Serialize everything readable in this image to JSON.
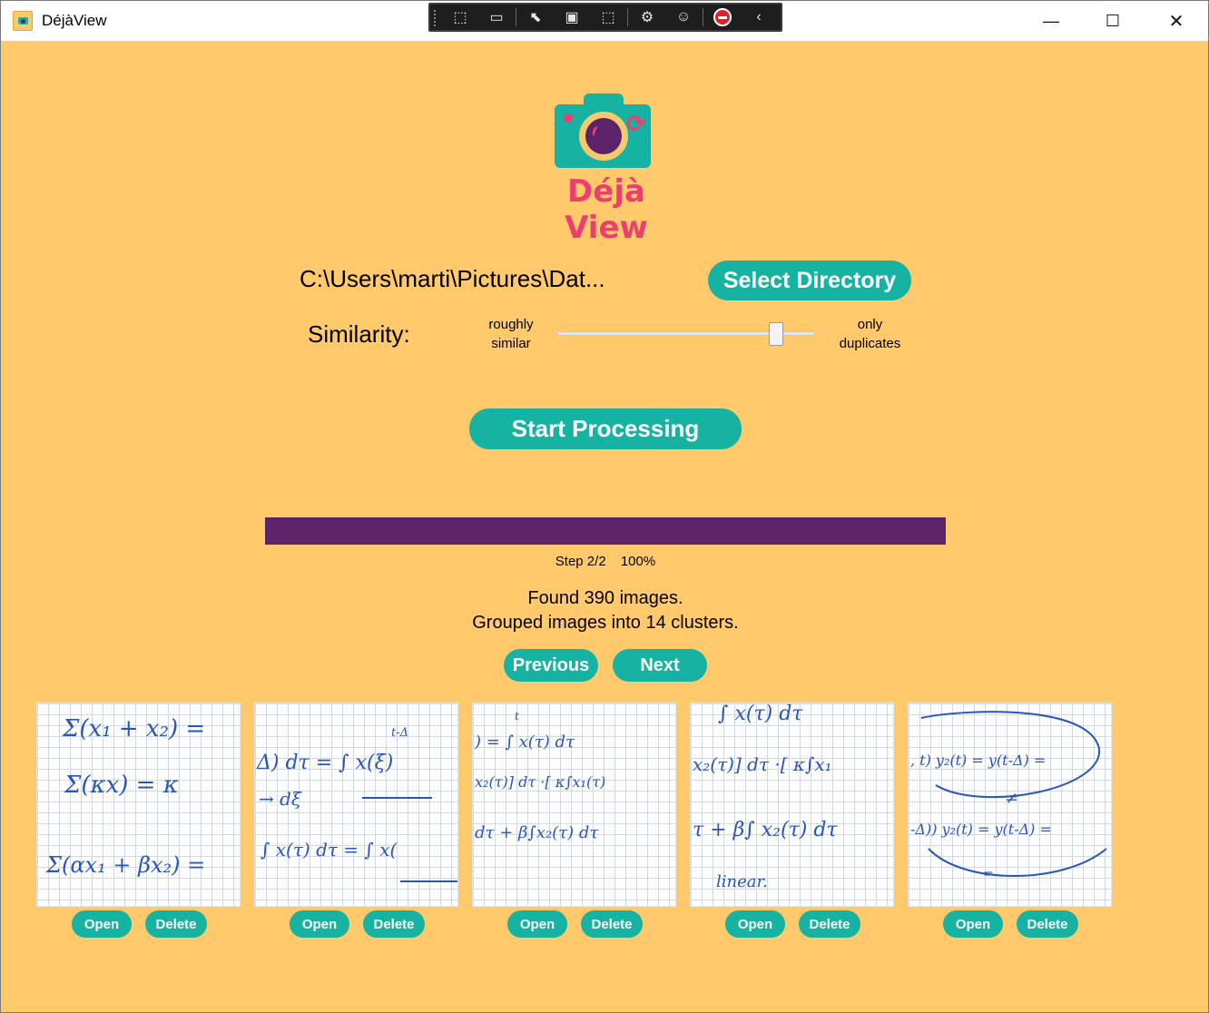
{
  "window": {
    "title": "DéjàView",
    "minimize": "—",
    "maximize": "☐",
    "close": "✕"
  },
  "devtools": {
    "icons": [
      "live-visual-tree-icon",
      "video-icon",
      "select-element-icon",
      "display-layout-icon",
      "track-focus-icon",
      "hot-reload-icon",
      "accessibility-icon",
      "stop-icon",
      "collapse-icon"
    ]
  },
  "logo": {
    "text": "Déjà View",
    "colors": {
      "accent": "#ec3f70",
      "teal": "#16b3a3",
      "purple": "#5c2368"
    }
  },
  "directory": {
    "path": "C:\\Users\\marti\\Pictures\\Dat...",
    "select_label": "Select Directory"
  },
  "similarity": {
    "label": "Similarity:",
    "left_line1": "roughly",
    "left_line2": "similar",
    "right_line1": "only",
    "right_line2": "duplicates",
    "value": 0.85
  },
  "start_label": "Start Processing",
  "progress": {
    "step": "Step 2/2",
    "percent": "100%",
    "value": 1.0
  },
  "results": {
    "line1": "Found 390 images.",
    "line2": "Grouped images into 14 clusters."
  },
  "nav": {
    "previous": "Previous",
    "next": "Next"
  },
  "thumbnails": [
    {
      "open": "Open",
      "delete": "Delete",
      "formula": [
        "Σ(x₁ + x₂) =",
        "Σ(κx) = κ",
        "Σ(αx₁ + βx₂) ="
      ]
    },
    {
      "open": "Open",
      "delete": "Delete",
      "formula": [
        "t-Δ",
        "Δ) dτ = ∫ x(ξ)",
        "→ dξ",
        "∫ x(τ) dτ = ∫ x("
      ]
    },
    {
      "open": "Open",
      "delete": "Delete",
      "formula": [
        "t",
        ") = ∫ x(τ) dτ",
        "x₂(τ)] dτ ·[ κ∫x₁(τ)",
        "dτ + β∫x₂(τ) dτ"
      ]
    },
    {
      "open": "Open",
      "delete": "Delete",
      "formula": [
        "∫ x(τ) dτ",
        "x₂(τ)] dτ ·[ κ∫x₁",
        "τ + β∫ x₂(τ) dτ",
        "linear."
      ]
    },
    {
      "open": "Open",
      "delete": "Delete",
      "formula": [
        ", t)   y₂(t) = y(t-Δ) =",
        "≠",
        "-Δ))   y₂(t) = y(t-Δ) =",
        "="
      ]
    }
  ]
}
